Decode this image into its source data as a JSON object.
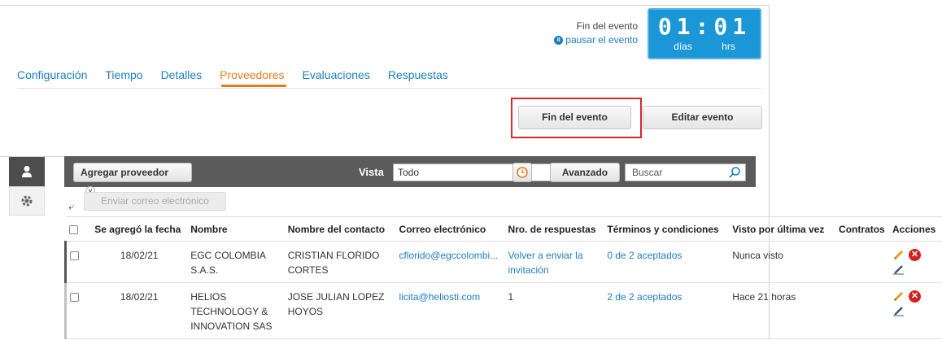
{
  "event": {
    "end_label": "Fin del evento",
    "pause_label": "pausar el evento",
    "timer_digits": "01:01",
    "timer_days_label": "días",
    "timer_hours_label": "hrs"
  },
  "tabs": [
    {
      "label": "Configuración"
    },
    {
      "label": "Tiempo"
    },
    {
      "label": "Detalles"
    },
    {
      "label": "Proveedores",
      "active": true
    },
    {
      "label": "Evaluaciones"
    },
    {
      "label": "Respuestas"
    }
  ],
  "actions": {
    "end_event": "Fin del evento",
    "edit_event": "Editar evento"
  },
  "toolbar": {
    "add_supplier": "Agregar proveedor",
    "view_label": "Vista",
    "view_value": "Todo",
    "advanced": "Avanzado",
    "search_placeholder": "Buscar"
  },
  "email_button": "Enviar correo electrónico",
  "table": {
    "headers": {
      "date": "Se agregó la fecha",
      "name": "Nombre",
      "contact": "Nombre del contacto",
      "email": "Correo electrónico",
      "responses": "Nro. de respuestas",
      "terms": "Términos y condiciones",
      "last_seen": "Visto por última vez",
      "contracts": "Contratos",
      "actions": "Acciones"
    },
    "rows": [
      {
        "date": "18/02/21",
        "name": "EGC COLOMBIA S.A.S.",
        "contact": "CRISTIAN FLORIDO CORTES",
        "email": "cflorido@egccolombi...",
        "responses": "Volver a enviar la invitación",
        "terms": "0 de 2 aceptados",
        "last_seen": "Nunca visto",
        "contracts": ""
      },
      {
        "date": "18/02/21",
        "name": "HELIOS TECHNOLOGY & INNOVATION SAS",
        "contact": "JOSE JULIAN LOPEZ HOYOS",
        "email": "licita@heliosti.com",
        "responses": "1",
        "terms": "2 de 2 aceptados",
        "last_seen": "Hace 21 horas",
        "contracts": ""
      }
    ]
  },
  "colors": {
    "accent": "#1a7fc1",
    "active_tab": "#e37c20",
    "timer_bg": "#1b96d6",
    "toolbar_bg": "#5b5b5b",
    "highlight": "#d62828"
  }
}
